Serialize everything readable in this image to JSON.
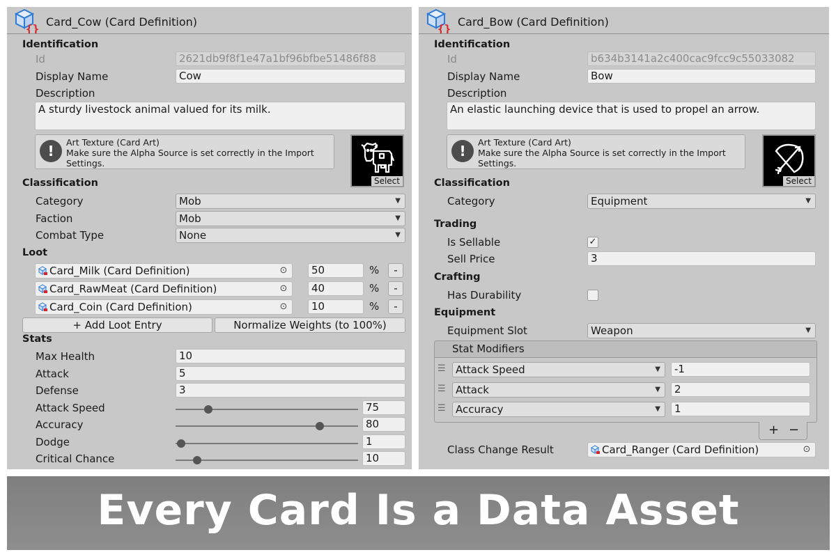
{
  "left": {
    "title": "Card_Cow (Card Definition)",
    "identification": {
      "heading": "Identification",
      "id_label": "Id",
      "id_value": "2621db9f8f1e47a1bf96bfbe51486f88",
      "display_name_label": "Display Name",
      "display_name": "Cow",
      "description_label": "Description",
      "description": "A sturdy livestock animal valued for its milk.",
      "help_lines": [
        "Art Texture (Card Art)",
        "Make sure the Alpha Source is set correctly in the Import",
        "Settings."
      ],
      "art_icon": "cow-icon",
      "select_label": "Select"
    },
    "classification": {
      "heading": "Classification",
      "category_label": "Category",
      "category": "Mob",
      "faction_label": "Faction",
      "faction": "Mob",
      "combat_type_label": "Combat Type",
      "combat_type": "None"
    },
    "loot": {
      "heading": "Loot",
      "entries": [
        {
          "asset": "Card_Milk (Card Definition)",
          "weight": "50",
          "unit": "%",
          "remove": "-"
        },
        {
          "asset": "Card_RawMeat (Card Definition)",
          "weight": "40",
          "unit": "%",
          "remove": "-"
        },
        {
          "asset": "Card_Coin (Card Definition)",
          "weight": "10",
          "unit": "%",
          "remove": "-"
        }
      ],
      "add_button": "+ Add Loot Entry",
      "normalize_button": "Normalize Weights (to 100%)"
    },
    "stats": {
      "heading": "Stats",
      "max_health_label": "Max Health",
      "max_health": "10",
      "attack_label": "Attack",
      "attack": "5",
      "defense_label": "Defense",
      "defense": "3",
      "sliders": [
        {
          "label": "Attack Speed",
          "value": "75",
          "fraction": 0.18
        },
        {
          "label": "Accuracy",
          "value": "80",
          "fraction": 0.79
        },
        {
          "label": "Dodge",
          "value": "1",
          "fraction": 0.03
        },
        {
          "label": "Critical Chance",
          "value": "10",
          "fraction": 0.12
        }
      ]
    }
  },
  "right": {
    "title": "Card_Bow (Card Definition)",
    "identification": {
      "heading": "Identification",
      "id_label": "Id",
      "id_value": "b634b3141a2c400cac9fcc9c55033082",
      "display_name_label": "Display Name",
      "display_name": "Bow",
      "description_label": "Description",
      "description": "An elastic launching device that is used to propel an arrow.",
      "help_lines": [
        "Art Texture (Card Art)",
        "Make sure the Alpha Source is set correctly in the Import",
        "Settings."
      ],
      "art_icon": "bow-and-arrow-icon",
      "select_label": "Select"
    },
    "classification": {
      "heading": "Classification",
      "category_label": "Category",
      "category": "Equipment"
    },
    "trading": {
      "heading": "Trading",
      "is_sellable_label": "Is Sellable",
      "is_sellable": true,
      "sell_price_label": "Sell Price",
      "sell_price": "3"
    },
    "crafting": {
      "heading": "Crafting",
      "has_durability_label": "Has Durability",
      "has_durability": false
    },
    "equipment": {
      "heading": "Equipment",
      "slot_label": "Equipment Slot",
      "slot": "Weapon",
      "stat_modifiers_label": "Stat Modifiers",
      "modifiers": [
        {
          "stat": "Attack Speed",
          "value": "-1"
        },
        {
          "stat": "Attack",
          "value": "2"
        },
        {
          "stat": "Accuracy",
          "value": "1"
        }
      ],
      "add_symbol": "+",
      "remove_symbol": "−",
      "class_change_label": "Class Change Result",
      "class_change_value": "Card_Ranger (Card Definition)"
    }
  },
  "banner": {
    "text": "Every Card Is a Data Asset"
  }
}
